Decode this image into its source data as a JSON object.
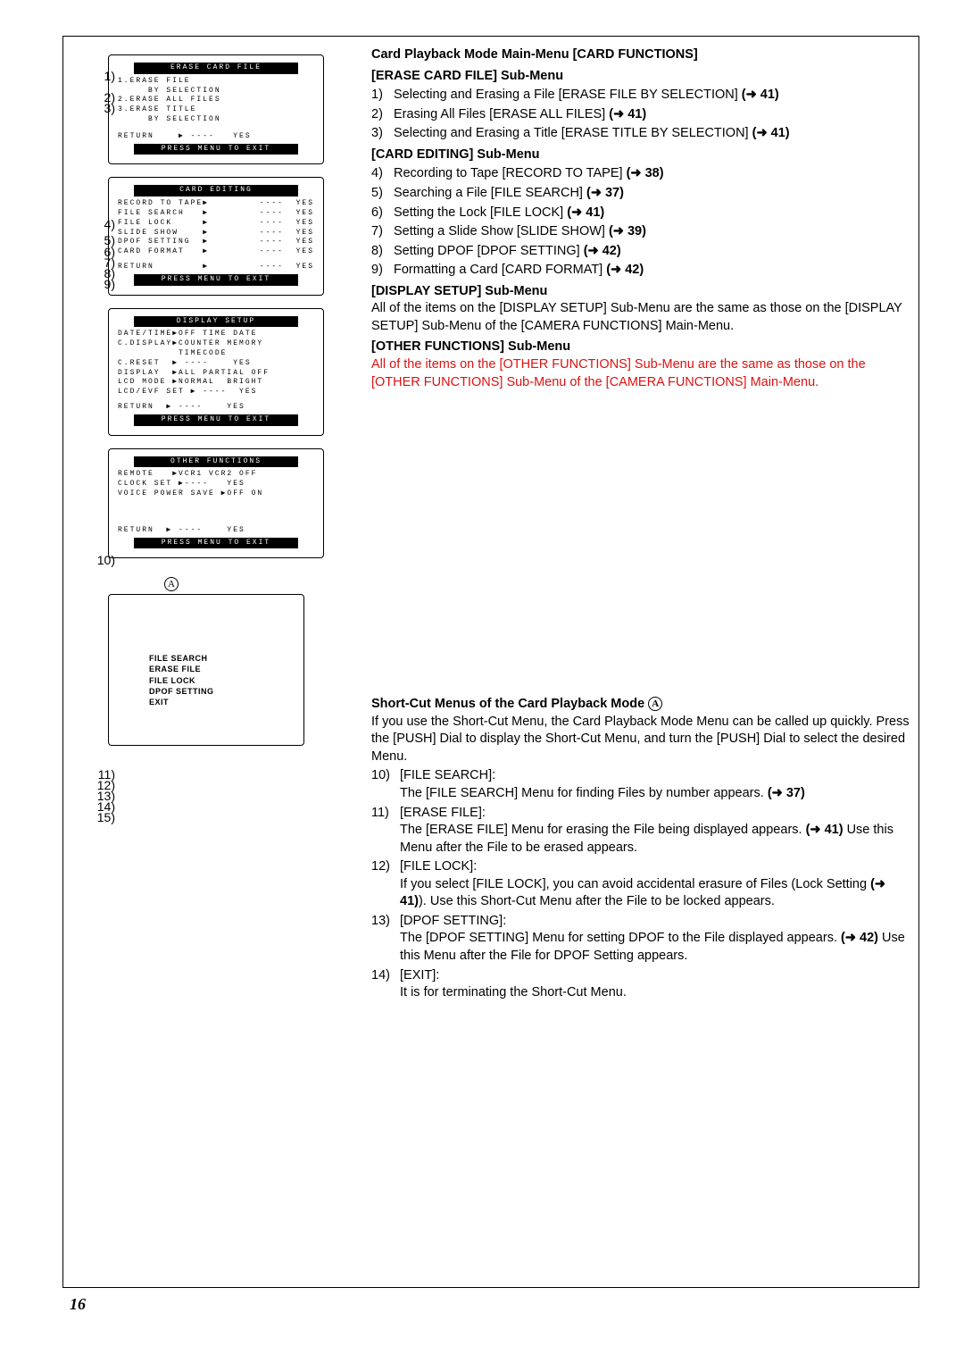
{
  "pageNumber": "16",
  "rightCol": {
    "h1": "Card Playback Mode Main-Menu [CARD FUNCTIONS]",
    "sec1": {
      "title": "[ERASE CARD FILE] Sub-Menu",
      "items": [
        {
          "n": "1)",
          "text": "Selecting and Erasing a File [ERASE FILE BY SELECTION] ",
          "ref": "(➜ 41)"
        },
        {
          "n": "2)",
          "text": "Erasing All Files [ERASE ALL FILES] ",
          "ref": "(➜ 41)"
        },
        {
          "n": "3)",
          "text": "Selecting and Erasing a Title [ERASE TITLE BY SELECTION] ",
          "ref": "(➜ 41)"
        }
      ]
    },
    "sec2": {
      "title": "[CARD EDITING] Sub-Menu",
      "items": [
        {
          "n": "4)",
          "text": "Recording to Tape [RECORD TO TAPE] ",
          "ref": "(➜ 38)"
        },
        {
          "n": "5)",
          "text": "Searching a File [FILE SEARCH] ",
          "ref": "(➜ 37)"
        },
        {
          "n": "6)",
          "text": "Setting the Lock [FILE LOCK] ",
          "ref": "(➜ 41)"
        },
        {
          "n": "7)",
          "text": "Setting a Slide Show [SLIDE SHOW] ",
          "ref": "(➜ 39)"
        },
        {
          "n": "8)",
          "text": "Setting DPOF [DPOF SETTING] ",
          "ref": "(➜ 42)"
        },
        {
          "n": "9)",
          "text": "Formatting a Card [CARD FORMAT] ",
          "ref": "(➜ 42)"
        }
      ]
    },
    "sec3": {
      "title": "[DISPLAY SETUP] Sub-Menu",
      "body": "All of the items on the [DISPLAY SETUP] Sub-Menu are the same as those on the [DISPLAY SETUP] Sub-Menu of the [CAMERA FUNCTIONS] Main-Menu."
    },
    "sec4": {
      "title": "[OTHER FUNCTIONS] Sub-Menu",
      "redBody": "All of the items on the [OTHER FUNCTIONS] Sub-Menu are the same as those on the [OTHER FUNCTIONS] Sub-Menu of the [CAMERA FUNCTIONS] Main-Menu."
    },
    "shortcut": {
      "title": "Short-Cut Menus of the Card Playback Mode ",
      "intro": "If you use the Short-Cut Menu, the Card Playback Mode Menu can be called up quickly. Press the [PUSH] Dial to display the Short-Cut Menu, and turn the [PUSH] Dial to select the desired Menu.",
      "items": [
        {
          "n": "10)",
          "label": "[FILE SEARCH]:",
          "body1": "The [FILE SEARCH] Menu for finding Files by number appears. ",
          "ref1": "(➜ 37)"
        },
        {
          "n": "11)",
          "label": "[ERASE FILE]:",
          "body1": "The [ERASE FILE] Menu for erasing the File being displayed appears. ",
          "ref1": "(➜ 41)",
          "body2": " Use this Menu after the File to be erased appears."
        },
        {
          "n": "12)",
          "label": "[FILE LOCK]:",
          "body1": "If you select [FILE LOCK], you can avoid accidental erasure of Files (Lock Setting ",
          "ref1": "(➜ 41)",
          "body2": "). Use this Short-Cut Menu after the File to be locked appears."
        },
        {
          "n": "13)",
          "label": "[DPOF SETTING]:",
          "body1": "The [DPOF SETTING] Menu for setting DPOF to the File displayed appears. ",
          "ref1": "(➜ 42)",
          "body2": " Use this Menu after the File for DPOF Setting appears."
        },
        {
          "n": "14)",
          "label": "[EXIT]:",
          "body1": "It is for terminating the Short-Cut Menu."
        }
      ]
    }
  },
  "callouts": {
    "c1": "1)",
    "c2": "2)",
    "c3": "3)",
    "c4": "4)",
    "c5": "5)",
    "c6": "6)",
    "c7": "7)",
    "c8": "8)",
    "c9": "9)",
    "c10": "10)",
    "c11": "11)",
    "c12": "12)",
    "c13": "13)",
    "c14": "14)",
    "c15": "15)"
  },
  "lcd1": {
    "title": "ERASE CARD FILE",
    "l1": "1.ERASE FILE",
    "l2": "     BY SELECTION",
    "l3": "2.ERASE ALL FILES",
    "l4": "3.ERASE TITLE",
    "l5": "     BY SELECTION",
    "ret": "RETURN    ▶ ----   YES",
    "footer": "PRESS MENU TO EXIT"
  },
  "lcd2": {
    "title": "CARD EDITING",
    "l1": {
      "a": "RECORD TO TAPE▶",
      "b": "----  YES"
    },
    "l2": {
      "a": "FILE SEARCH   ▶",
      "b": "----  YES"
    },
    "l3": {
      "a": "FILE LOCK     ▶",
      "b": "----  YES"
    },
    "l4": {
      "a": "SLIDE SHOW    ▶",
      "b": "----  YES"
    },
    "l5": {
      "a": "DPOF SETTING  ▶",
      "b": "----  YES"
    },
    "l6": {
      "a": "CARD FORMAT   ▶",
      "b": "----  YES"
    },
    "ret": {
      "a": "RETURN        ▶",
      "b": "----  YES"
    },
    "footer": "PRESS MENU TO EXIT"
  },
  "lcd3": {
    "title": "DISPLAY SETUP",
    "l1": "DATE/TIME▶OFF TIME DATE",
    "l2": "C.DISPLAY▶COUNTER MEMORY",
    "l3": "          TIMECODE",
    "l4": "C.RESET  ▶ ----    YES",
    "l5": "DISPLAY  ▶ALL PARTIAL OFF",
    "l6": "LCD MODE ▶NORMAL  BRIGHT",
    "l7": "LCD/EVF SET ▶ ----  YES",
    "ret": "RETURN  ▶ ----    YES",
    "footer": "PRESS MENU TO EXIT"
  },
  "lcd4": {
    "title": "OTHER FUNCTIONS",
    "l1": "REMOTE   ▶VCR1 VCR2 OFF",
    "l2": "CLOCK SET ▶----   YES",
    "l3": "VOICE POWER SAVE ▶OFF ON",
    "ret": "RETURN  ▶ ----    YES",
    "footer": "PRESS MENU TO EXIT"
  },
  "shortcutScreen": {
    "items": [
      "FILE SEARCH",
      "ERASE FILE",
      "FILE LOCK",
      "DPOF SETTING",
      "EXIT"
    ],
    "A": "A"
  }
}
